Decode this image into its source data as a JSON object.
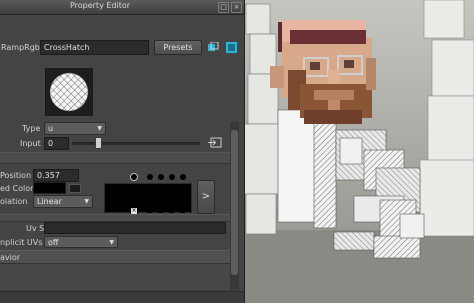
{
  "window": {
    "title": "Property Editor",
    "float_icon": "float-window-icon",
    "close_icon": "close-icon"
  },
  "ramp": {
    "label": "RampRgb:",
    "name": "CrossHatch",
    "presets_label": "Presets",
    "presets_icon": "preset-icon",
    "map_icon": "map-icon"
  },
  "type": {
    "label": "Type",
    "value": "u"
  },
  "input": {
    "label": "Input",
    "value": "0",
    "slider_fraction": 0.2,
    "map_icon": "connection-icon"
  },
  "color_entry": {
    "position_label": "Position",
    "position_value": "0.357",
    "color_label": "ed Color",
    "color_value": "#000000",
    "interp_label": "olation",
    "interp_value": "Linear",
    "expand_label": ">"
  },
  "uv_set": {
    "label": "Uv Set"
  },
  "implicit_uvs": {
    "label": "nplicit UVs",
    "value": "off"
  },
  "behavior": {
    "label": "avior"
  },
  "colors": {
    "panel": "#444444",
    "field": "#2b2b2b",
    "accent_cyan": "#2fb4d8",
    "beard": "#7a4a30",
    "shirt": "#5a2a2a"
  }
}
